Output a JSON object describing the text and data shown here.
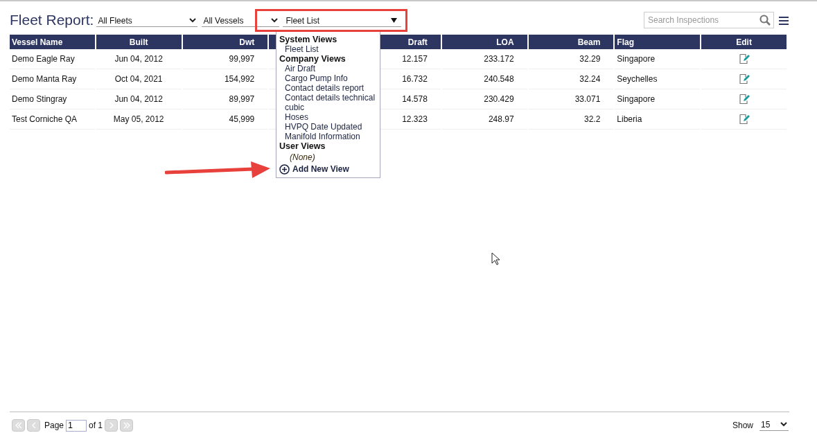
{
  "header": {
    "title": "Fleet Report:",
    "fleet_select": "All Fleets",
    "vessel_select": "All Vessels",
    "view_select": "Fleet List",
    "search": {
      "placeholder": "Search Inspections"
    }
  },
  "table": {
    "columns": [
      "Vessel Name",
      "Built",
      "Dwt",
      "Draft",
      "LOA",
      "Beam",
      "Flag",
      "Edit"
    ],
    "rows": [
      {
        "cells": [
          "Demo Eagle Ray",
          "Jun 04, 2012",
          "99,997",
          "12.157",
          "233.172",
          "32.29",
          "Singapore"
        ]
      },
      {
        "cells": [
          "Demo Manta Ray",
          "Oct 04, 2021",
          "154,992",
          "16.732",
          "240.548",
          "32.24",
          "Seychelles"
        ]
      },
      {
        "cells": [
          "Demo Stingray",
          "Jun 04, 2012",
          "89,997",
          "14.578",
          "230.429",
          "33.071",
          "Singapore"
        ]
      },
      {
        "cells": [
          "Test Corniche QA",
          "May 05, 2012",
          "45,999",
          "12.323",
          "248.97",
          "32.2",
          "Liberia"
        ]
      }
    ]
  },
  "view_menu": {
    "groups": [
      {
        "heading": "System Views",
        "items": [
          {
            "label": "Fleet List",
            "kind": "view"
          }
        ]
      },
      {
        "heading": "Company Views",
        "items": [
          {
            "label": "Air Draft",
            "kind": "view"
          },
          {
            "label": "Cargo Pump Info",
            "kind": "view"
          },
          {
            "label": "Contact details report",
            "kind": "view"
          },
          {
            "label": "Contact details technical",
            "kind": "view"
          },
          {
            "label": "cubic",
            "kind": "view"
          },
          {
            "label": "Hoses",
            "kind": "view"
          },
          {
            "label": "HVPQ Date Updated",
            "kind": "view"
          },
          {
            "label": "Manifold Information",
            "kind": "view"
          }
        ]
      },
      {
        "heading": "User Views",
        "items": [
          {
            "label": "(None)",
            "kind": "empty"
          }
        ]
      }
    ],
    "action": "Add New View"
  },
  "pager": {
    "page_label": "Page",
    "page": "1",
    "of_label": "of 1",
    "show_label": "Show",
    "page_size": "15"
  }
}
